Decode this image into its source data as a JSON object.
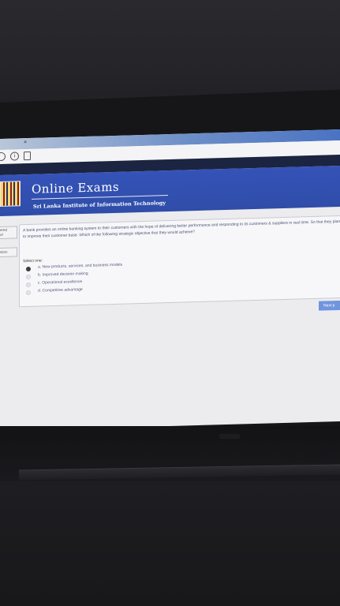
{
  "browser": {
    "close_glyph": "×",
    "info_icon": "info-icon",
    "page_icon": "document-icon"
  },
  "header": {
    "title": "Online Exams",
    "subtitle": "Sri Lanka Institute of Information Technology"
  },
  "sidebar": {
    "label_1": "ered",
    "label_2": "of",
    "label_3": "stion"
  },
  "question": {
    "text": "A bank provides an online banking system to their customers with the hope of delivering better performance and responding to its customers & suppliers in real time. So that they plan to improve their customer base. Which of the following strategic objective that they would achieve?",
    "prompt": "Select one:",
    "options": [
      {
        "label": "a. New products, services, and business models",
        "selected": true
      },
      {
        "label": "b. Improved decision making",
        "selected": false
      },
      {
        "label": "c. Operational excellence",
        "selected": false
      },
      {
        "label": "d. Competitive advantage",
        "selected": false
      }
    ]
  },
  "actions": {
    "next_label": "Next p"
  },
  "colors": {
    "header_blue": "#2f4da8",
    "dark_band": "#1b2440",
    "button_blue": "#6f95dd"
  }
}
